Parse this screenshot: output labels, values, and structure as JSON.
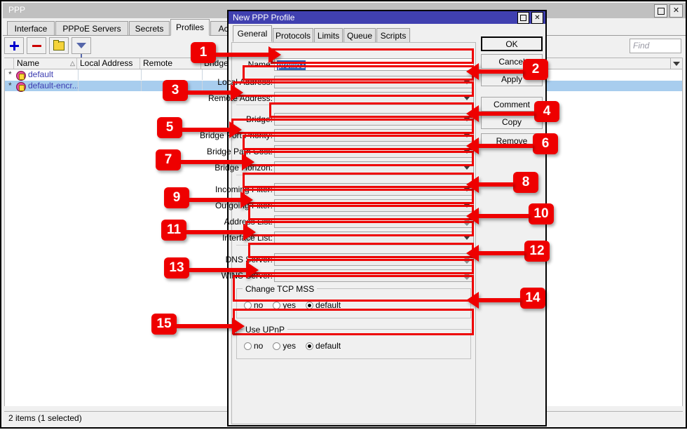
{
  "main_window": {
    "title": "PPP",
    "controls": {
      "maximize": "maximize-icon",
      "close": "✕"
    },
    "tabs": [
      {
        "label": "Interface",
        "active": false
      },
      {
        "label": "PPPoE Servers",
        "active": false
      },
      {
        "label": "Secrets",
        "active": false
      },
      {
        "label": "Profiles",
        "active": true
      },
      {
        "label": "Active Connect",
        "active": false
      }
    ],
    "toolbar": [
      {
        "name": "add-button",
        "icon": "plus-icon"
      },
      {
        "name": "remove-button",
        "icon": "minus-icon"
      },
      {
        "name": "enable-button",
        "icon": "folder-icon"
      },
      {
        "name": "filter-button",
        "icon": "funnel-icon"
      }
    ],
    "find": {
      "placeholder": "Find",
      "value": ""
    },
    "table": {
      "columns": [
        "Name",
        "Local Address",
        "Remote Address",
        "Bridge"
      ],
      "sort_column": "Name",
      "rows": [
        {
          "flag": "*",
          "name": "default",
          "local_address": "",
          "remote_address": "",
          "bridge": "",
          "selected": false
        },
        {
          "flag": "*",
          "name": "default-encr...",
          "local_address": "",
          "remote_address": "",
          "bridge": "",
          "selected": true
        }
      ]
    },
    "status": "2 items (1 selected)"
  },
  "dialog": {
    "title": "New PPP Profile",
    "controls": {
      "maximize": "maximize-icon",
      "close": "✕"
    },
    "tabs": [
      {
        "label": "General",
        "active": true
      },
      {
        "label": "Protocols",
        "active": false
      },
      {
        "label": "Limits",
        "active": false
      },
      {
        "label": "Queue",
        "active": false
      },
      {
        "label": "Scripts",
        "active": false
      }
    ],
    "fields": [
      {
        "label": "Name:",
        "value": "profile1",
        "control": "text",
        "selected_text": true
      },
      {
        "label": "Local Address:",
        "value": "",
        "control": "dropdown"
      },
      {
        "label": "Remote Address:",
        "value": "",
        "control": "dropdown"
      },
      {
        "label": "Bridge:",
        "value": "",
        "control": "dropdown"
      },
      {
        "label": "Bridge Port Priority:",
        "value": "",
        "control": "dropdown"
      },
      {
        "label": "Bridge Path Cost:",
        "value": "",
        "control": "dropdown"
      },
      {
        "label": "Bridge Horizon:",
        "value": "",
        "control": "dropdown"
      },
      {
        "label": "Incoming Filter:",
        "value": "",
        "control": "dropdown"
      },
      {
        "label": "Outgoing Filter:",
        "value": "",
        "control": "dropdown"
      },
      {
        "label": "Address List:",
        "value": "",
        "control": "spinner"
      },
      {
        "label": "Interface List:",
        "value": "",
        "control": "dropdown"
      },
      {
        "label": "DNS Server:",
        "value": "",
        "control": "spinner"
      },
      {
        "label": "WINS Server:",
        "value": "",
        "control": "spinner"
      }
    ],
    "groups": [
      {
        "title": "Change TCP MSS",
        "options": [
          {
            "label": "no",
            "selected": false
          },
          {
            "label": "yes",
            "selected": false
          },
          {
            "label": "default",
            "selected": true
          }
        ]
      },
      {
        "title": "Use UPnP",
        "options": [
          {
            "label": "no",
            "selected": false
          },
          {
            "label": "yes",
            "selected": false
          },
          {
            "label": "default",
            "selected": true
          }
        ]
      }
    ],
    "buttons": [
      {
        "label": "OK",
        "primary": true
      },
      {
        "label": "Cancel",
        "primary": false
      },
      {
        "label": "Apply",
        "primary": false
      },
      {
        "label": "Comment",
        "primary": false
      },
      {
        "label": "Copy",
        "primary": false
      },
      {
        "label": "Remove",
        "primary": false
      }
    ]
  },
  "annotations": {
    "accent_color": "#ee0000",
    "badges": [
      {
        "n": "1",
        "target": "Name field"
      },
      {
        "n": "2",
        "target": "Local Address dropdown"
      },
      {
        "n": "3",
        "target": "Remote Address dropdown"
      },
      {
        "n": "4",
        "target": "Bridge dropdown"
      },
      {
        "n": "5",
        "target": "Bridge Port Priority dropdown"
      },
      {
        "n": "6",
        "target": "Bridge Path Cost dropdown"
      },
      {
        "n": "7",
        "target": "Bridge Horizon dropdown"
      },
      {
        "n": "8",
        "target": "Incoming Filter dropdown"
      },
      {
        "n": "9",
        "target": "Outgoing Filter dropdown"
      },
      {
        "n": "10",
        "target": "Address List spinner"
      },
      {
        "n": "11",
        "target": "Interface List dropdown"
      },
      {
        "n": "12",
        "target": "DNS Server spinner"
      },
      {
        "n": "13",
        "target": "WINS Server spinner"
      },
      {
        "n": "14",
        "target": "Change TCP MSS group"
      },
      {
        "n": "15",
        "target": "Use UPnP group"
      }
    ]
  }
}
